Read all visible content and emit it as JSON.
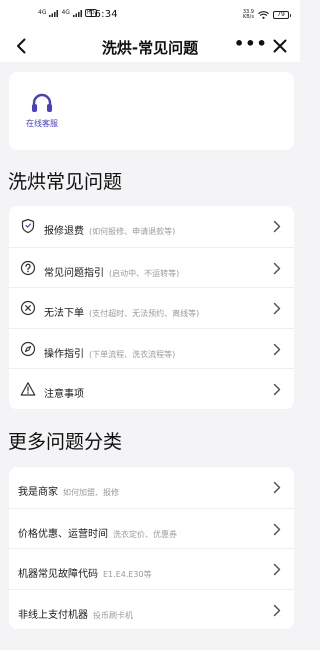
{
  "status_bar": {
    "signal1": "4G",
    "signal2": "4G",
    "hd": "HD",
    "time": "16:34",
    "speed_value": "33.9",
    "speed_unit": "KB/s",
    "battery": "79"
  },
  "nav": {
    "title": "洗烘-常见问题",
    "more": "•••"
  },
  "service": {
    "label": "在线客服"
  },
  "faq_section": {
    "title": "洗烘常见问题",
    "items": [
      {
        "title": "报修退费",
        "hint": "(如何报修、申请退款等)",
        "icon": "shield-icon"
      },
      {
        "title": "常见问题指引",
        "hint": "(启动中、不运转等)",
        "icon": "question-circle-icon"
      },
      {
        "title": "无法下单",
        "hint": "(支付超时、无法预约、离线等)",
        "icon": "x-circle-icon"
      },
      {
        "title": "操作指引",
        "hint": "(下单流程、洗衣流程等)",
        "icon": "compass-icon"
      },
      {
        "title": "注意事项",
        "hint": "",
        "icon": "warning-icon"
      }
    ]
  },
  "more_section": {
    "title": "更多问题分类",
    "items": [
      {
        "title": "我是商家",
        "hint": "如何加盟、报修"
      },
      {
        "title": "价格优惠、运营时间",
        "hint": "洗衣定价、优惠券"
      },
      {
        "title": "机器常见故障代码",
        "hint": "E1.E4.E30等"
      },
      {
        "title": "非线上支付机器",
        "hint": "投币刷卡机"
      }
    ]
  },
  "colors": {
    "accent": "#4a3fbf",
    "background": "#f4f4f6",
    "card": "#ffffff",
    "hint": "#9a9a9a"
  }
}
